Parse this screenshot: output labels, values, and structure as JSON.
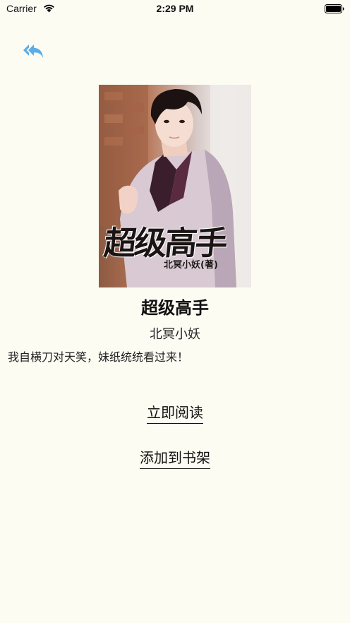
{
  "status_bar": {
    "carrier": "Carrier",
    "time": "2:29 PM",
    "icons": [
      "wifi-icon",
      "battery-icon"
    ]
  },
  "nav": {
    "back_icon": "reply-arrow-icon",
    "back_color": "#5aaee8"
  },
  "cover": {
    "title": "超级高手",
    "author": "北冥小妖(著)"
  },
  "book": {
    "title": "超级高手",
    "author": "北冥小妖",
    "intro": "我自横刀对天笑，妹纸统统看过来！"
  },
  "actions": {
    "read_now": "立即阅读",
    "add_to_shelf": "添加到书架"
  },
  "colors": {
    "background": "#fdfcf3",
    "accent": "#5aaee8"
  }
}
